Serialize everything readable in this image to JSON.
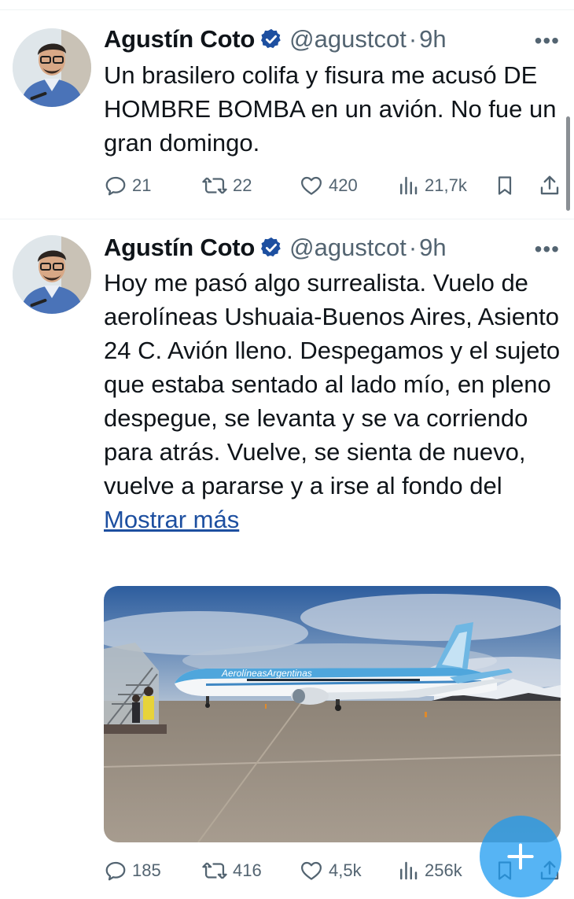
{
  "colors": {
    "accent": "#1d9bf0",
    "muted": "#536471",
    "text": "#0f1419",
    "link": "#1d4fa0"
  },
  "tweets": [
    {
      "author": {
        "name": "Agustín Coto",
        "handle": "@agustcot",
        "verified": true
      },
      "separator": "·",
      "time": "9h",
      "more": "•••",
      "text": "Un brasilero colifa y fisura me acusó DE HOMBRE BOMBA en un avión. No fue un gran domingo.",
      "stats": {
        "replies": "21",
        "retweets": "22",
        "likes": "420",
        "views": "21,7k"
      }
    },
    {
      "author": {
        "name": "Agustín Coto",
        "handle": "@agustcot",
        "verified": true
      },
      "separator": "·",
      "time": "9h",
      "more": "•••",
      "text": "Hoy me pasó algo surrealista. Vuelo de aerolíneas Ushuaia-Buenos Aires, Asiento 24 C. Avión lleno. Despegamos y el sujeto que estaba sentado al lado mío, en pleno despegue, se levanta y se va corriendo para atrás. Vuelve, se sienta de nuevo, vuelve a pararse y a irse al fondo del",
      "show_more": "Mostrar más",
      "media": {
        "plane_livery": "AerolíneasArgentinas"
      },
      "stats": {
        "replies": "185",
        "retweets": "416",
        "likes": "4,5k",
        "views": "256k"
      }
    }
  ],
  "fab": {
    "icon": "compose-plus-icon"
  }
}
